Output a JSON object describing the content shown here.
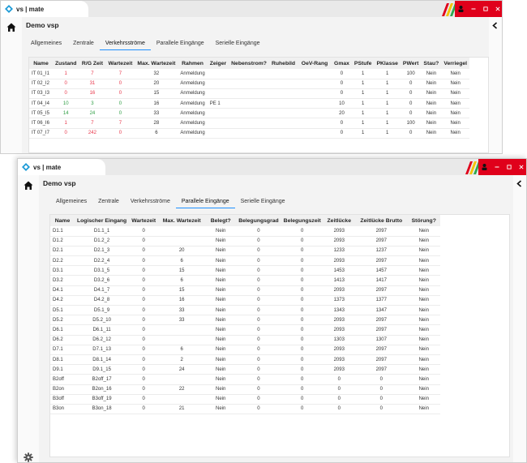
{
  "window1": {
    "app_name": "vs | mate",
    "page_title": "Demo vsp",
    "tabs": [
      "Allgemeines",
      "Zentrale",
      "Verkehrsströme",
      "Parallele Eingänge",
      "Serielle Eingänge"
    ],
    "active_tab": 2,
    "columns": [
      "Name",
      "Zustand",
      "R/G Zeit",
      "Wartezeit",
      "Max. Wartezeit",
      "Rahmen",
      "Zeiger",
      "Nebenstrom?",
      "Ruhebild",
      "OeV-Rang",
      "Gmax",
      "PStufe",
      "PKlasse",
      "PWert",
      "Stau?",
      "Verriegel"
    ],
    "rows": [
      {
        "name": "IT 01_I1",
        "zustand": "1",
        "zustand_color": "red",
        "rg": "7",
        "rg_color": "red",
        "warte": "7",
        "warte_color": "red",
        "maxw": "32",
        "rahmen": "Anmeldung",
        "zeiger": "",
        "gmax": "0",
        "pstufe": "1",
        "pklasse": "1",
        "pwert": "100",
        "stau": "Nein",
        "verr": "Nein"
      },
      {
        "name": "IT 02_I2",
        "zustand": "0",
        "zustand_color": "red",
        "rg": "31",
        "rg_color": "red",
        "warte": "0",
        "warte_color": "red",
        "maxw": "20",
        "rahmen": "Anmeldung",
        "zeiger": "",
        "gmax": "0",
        "pstufe": "1",
        "pklasse": "1",
        "pwert": "0",
        "stau": "Nein",
        "verr": "Nein"
      },
      {
        "name": "IT 03_I3",
        "zustand": "0",
        "zustand_color": "red",
        "rg": "16",
        "rg_color": "red",
        "warte": "0",
        "warte_color": "red",
        "maxw": "15",
        "rahmen": "Anmeldung",
        "zeiger": "",
        "gmax": "0",
        "pstufe": "1",
        "pklasse": "1",
        "pwert": "0",
        "stau": "Nein",
        "verr": "Nein"
      },
      {
        "name": "IT 04_I4",
        "zustand": "10",
        "zustand_color": "green",
        "rg": "3",
        "rg_color": "green",
        "warte": "0",
        "warte_color": "green",
        "maxw": "16",
        "rahmen": "Anmeldung",
        "zeiger": "PE 1",
        "gmax": "10",
        "pstufe": "1",
        "pklasse": "1",
        "pwert": "0",
        "stau": "Nein",
        "verr": "Nein"
      },
      {
        "name": "IT 05_I5",
        "zustand": "14",
        "zustand_color": "green",
        "rg": "24",
        "rg_color": "green",
        "warte": "0",
        "warte_color": "green",
        "maxw": "33",
        "rahmen": "Anmeldung",
        "zeiger": "",
        "gmax": "20",
        "pstufe": "1",
        "pklasse": "1",
        "pwert": "0",
        "stau": "Nein",
        "verr": "Nein"
      },
      {
        "name": "IT 06_I6",
        "zustand": "1",
        "zustand_color": "red",
        "rg": "7",
        "rg_color": "red",
        "warte": "7",
        "warte_color": "red",
        "maxw": "28",
        "rahmen": "Anmeldung",
        "zeiger": "",
        "gmax": "0",
        "pstufe": "1",
        "pklasse": "1",
        "pwert": "100",
        "stau": "Nein",
        "verr": "Nein"
      },
      {
        "name": "IT 07_I7",
        "zustand": "0",
        "zustand_color": "red",
        "rg": "242",
        "rg_color": "red",
        "warte": "0",
        "warte_color": "red",
        "maxw": "6",
        "rahmen": "Anmeldung",
        "zeiger": "",
        "gmax": "0",
        "pstufe": "1",
        "pklasse": "1",
        "pwert": "0",
        "stau": "Nein",
        "verr": "Nein"
      }
    ]
  },
  "window2": {
    "app_name": "vs | mate",
    "page_title": "Demo vsp",
    "tabs": [
      "Allgemeines",
      "Zentrale",
      "Verkehrsströme",
      "Parallele Eingänge",
      "Serielle Eingänge"
    ],
    "active_tab": 3,
    "columns": [
      "Name",
      "Logischer Eingang",
      "Wartezeit",
      "Max. Wartezeit",
      "Belegt?",
      "Belegungsgrad",
      "Belegungszeit",
      "Zeitlücke",
      "Zeitlücke Brutto",
      "Störung?"
    ],
    "rows": [
      {
        "name": "D1.1",
        "logic": "D1.1_1",
        "warte": "0",
        "maxw": "",
        "belegt": "Nein",
        "grad": "0",
        "zeit": "0",
        "luecke": "2093",
        "brutto": "2097",
        "stoer": "Nein"
      },
      {
        "name": "D1.2",
        "logic": "D1.2_2",
        "warte": "0",
        "maxw": "",
        "belegt": "Nein",
        "grad": "0",
        "zeit": "0",
        "luecke": "2093",
        "brutto": "2097",
        "stoer": "Nein"
      },
      {
        "name": "D2.1",
        "logic": "D2.1_3",
        "warte": "0",
        "maxw": "20",
        "belegt": "Nein",
        "grad": "0",
        "zeit": "0",
        "luecke": "1233",
        "brutto": "1237",
        "stoer": "Nein"
      },
      {
        "name": "D2.2",
        "logic": "D2.2_4",
        "warte": "0",
        "maxw": "6",
        "belegt": "Nein",
        "grad": "0",
        "zeit": "0",
        "luecke": "2093",
        "brutto": "2097",
        "stoer": "Nein"
      },
      {
        "name": "D3.1",
        "logic": "D3.1_5",
        "warte": "0",
        "maxw": "15",
        "belegt": "Nein",
        "grad": "0",
        "zeit": "0",
        "luecke": "1453",
        "brutto": "1457",
        "stoer": "Nein"
      },
      {
        "name": "D3.2",
        "logic": "D3.2_6",
        "warte": "0",
        "maxw": "6",
        "belegt": "Nein",
        "grad": "0",
        "zeit": "0",
        "luecke": "1413",
        "brutto": "1417",
        "stoer": "Nein"
      },
      {
        "name": "D4.1",
        "logic": "D4.1_7",
        "warte": "0",
        "maxw": "15",
        "belegt": "Nein",
        "grad": "0",
        "zeit": "0",
        "luecke": "2093",
        "brutto": "2097",
        "stoer": "Nein"
      },
      {
        "name": "D4.2",
        "logic": "D4.2_8",
        "warte": "0",
        "maxw": "16",
        "belegt": "Nein",
        "grad": "0",
        "zeit": "0",
        "luecke": "1373",
        "brutto": "1377",
        "stoer": "Nein"
      },
      {
        "name": "D5.1",
        "logic": "D5.1_9",
        "warte": "0",
        "maxw": "33",
        "belegt": "Nein",
        "grad": "0",
        "zeit": "0",
        "luecke": "1343",
        "brutto": "1347",
        "stoer": "Nein"
      },
      {
        "name": "D5.2",
        "logic": "D5.2_10",
        "warte": "0",
        "maxw": "33",
        "belegt": "Nein",
        "grad": "0",
        "zeit": "0",
        "luecke": "2093",
        "brutto": "2097",
        "stoer": "Nein"
      },
      {
        "name": "D6.1",
        "logic": "D6.1_11",
        "warte": "0",
        "maxw": "",
        "belegt": "Nein",
        "grad": "0",
        "zeit": "0",
        "luecke": "2093",
        "brutto": "2097",
        "stoer": "Nein"
      },
      {
        "name": "D6.2",
        "logic": "D6.2_12",
        "warte": "0",
        "maxw": "",
        "belegt": "Nein",
        "grad": "0",
        "zeit": "0",
        "luecke": "1303",
        "brutto": "1307",
        "stoer": "Nein"
      },
      {
        "name": "D7.1",
        "logic": "D7.1_13",
        "warte": "0",
        "maxw": "6",
        "belegt": "Nein",
        "grad": "0",
        "zeit": "0",
        "luecke": "2093",
        "brutto": "2097",
        "stoer": "Nein"
      },
      {
        "name": "D8.1",
        "logic": "D8.1_14",
        "warte": "0",
        "maxw": "2",
        "belegt": "Nein",
        "grad": "0",
        "zeit": "0",
        "luecke": "2093",
        "brutto": "2097",
        "stoer": "Nein"
      },
      {
        "name": "D9.1",
        "logic": "D9.1_15",
        "warte": "0",
        "maxw": "24",
        "belegt": "Nein",
        "grad": "0",
        "zeit": "0",
        "luecke": "2093",
        "brutto": "2097",
        "stoer": "Nein"
      },
      {
        "name": "B2off",
        "logic": "B2off_17",
        "warte": "0",
        "maxw": "",
        "belegt": "Nein",
        "grad": "0",
        "zeit": "0",
        "luecke": "0",
        "brutto": "0",
        "stoer": "Nein"
      },
      {
        "name": "B2on",
        "logic": "B2on_16",
        "warte": "0",
        "maxw": "22",
        "belegt": "Nein",
        "grad": "0",
        "zeit": "0",
        "luecke": "0",
        "brutto": "0",
        "stoer": "Nein"
      },
      {
        "name": "B3off",
        "logic": "B3off_19",
        "warte": "0",
        "maxw": "",
        "belegt": "Nein",
        "grad": "0",
        "zeit": "0",
        "luecke": "0",
        "brutto": "0",
        "stoer": "Nein"
      },
      {
        "name": "B3on",
        "logic": "B3on_18",
        "warte": "0",
        "maxw": "21",
        "belegt": "Nein",
        "grad": "0",
        "zeit": "0",
        "luecke": "0",
        "brutto": "0",
        "stoer": "Nein"
      }
    ]
  },
  "colors": {
    "window_controls": "#e0001b",
    "active_tab_underline": "#1e90ff",
    "state_red": "#e8364a",
    "state_green": "#2f9e44"
  },
  "icons": [
    "logo-icon",
    "stripe-icon",
    "user-icon",
    "minimize-icon",
    "maximize-icon",
    "close-icon",
    "home-icon",
    "gear-icon",
    "collapse-left-icon"
  ]
}
